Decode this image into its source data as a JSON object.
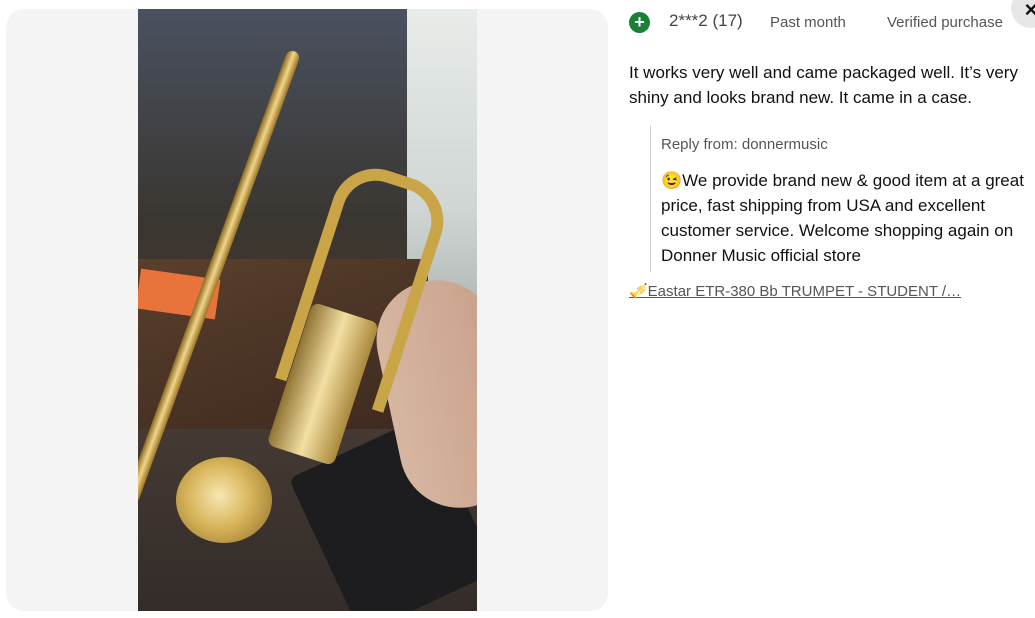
{
  "review": {
    "user": "2***2 (17)",
    "date": "Past month",
    "badge": "Verified purchase",
    "text": "It works very well and came packaged well. It’s very shiny and looks brand new. It came in a case.",
    "reply_from": "Reply from: donnermusic",
    "reply_text": "😉We provide brand new & good item at a great price, fast shipping from USA and excellent customer service. Welcome shopping again on Donner Music official store",
    "product_link": "🎺Eastar ETR-380 Bb TRUMPET - STUDENT /…"
  },
  "icons": {
    "add": "plus-circle-icon",
    "close": "close-icon"
  },
  "colors": {
    "accent": "#1a7f37"
  },
  "labels": {
    "add_symbol": "+",
    "close_symbol": "×"
  }
}
